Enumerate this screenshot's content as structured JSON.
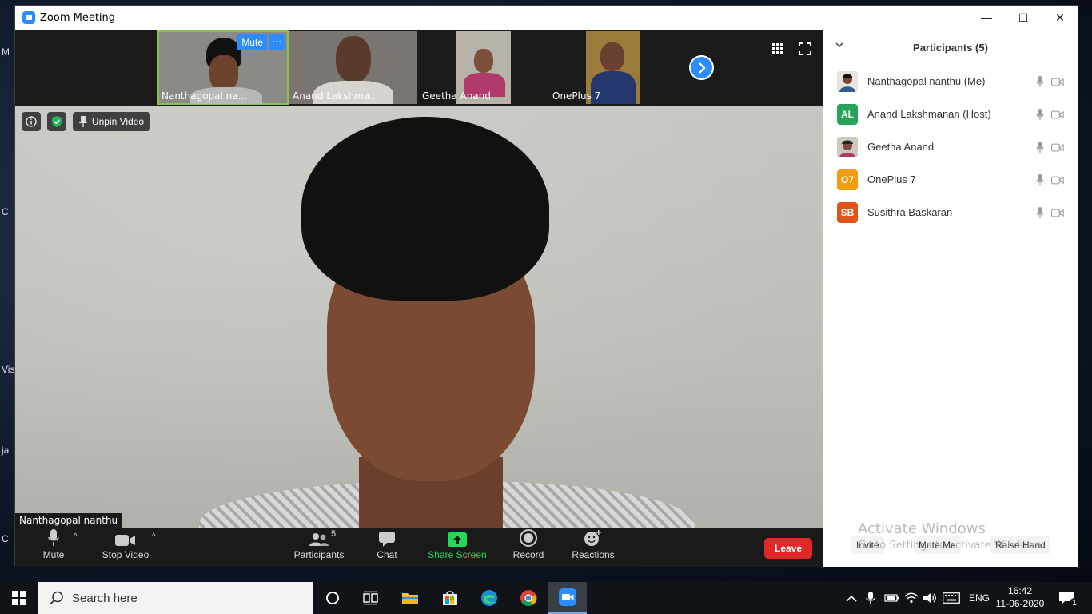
{
  "window": {
    "title": "Zoom Meeting",
    "controls": {
      "minimize": "—",
      "maximize": "☐",
      "close": "✕"
    }
  },
  "desktop_fragments": [
    "M",
    "C",
    "Vis",
    "ja",
    "C"
  ],
  "thumbnails": [
    {
      "name": "Nanthagopal na...",
      "mute_label": "Mute",
      "more_label": "···",
      "active": true
    },
    {
      "name": "Anand Lakshma..."
    },
    {
      "name": "Geetha Anand"
    },
    {
      "name": "OnePlus 7"
    }
  ],
  "overlay": {
    "unpin_label": "Unpin Video"
  },
  "main_video": {
    "name": "Nanthagopal nanthu"
  },
  "toolbar": {
    "mute_label": "Mute",
    "stop_video_label": "Stop Video",
    "participants_label": "Participants",
    "participants_count": "5",
    "chat_label": "Chat",
    "share_screen_label": "Share Screen",
    "record_label": "Record",
    "reactions_label": "Reactions",
    "leave_label": "Leave"
  },
  "panel": {
    "title": "Participants (5)",
    "participants": [
      {
        "name": "Nanthagopal nanthu (Me)",
        "initials": "",
        "color": "#5b7fa6"
      },
      {
        "name": "Anand Lakshmanan (Host)",
        "initials": "AL",
        "color": "#27a35a"
      },
      {
        "name": "Geetha Anand",
        "initials": "",
        "color": "#b58a6a"
      },
      {
        "name": "OnePlus 7",
        "initials": "O7",
        "color": "#f39c12"
      },
      {
        "name": "Susithra Baskaran",
        "initials": "SB",
        "color": "#e0541c"
      }
    ],
    "invite_label": "Invite",
    "mute_me_label": "Mute Me",
    "raise_hand_label": "Raise Hand"
  },
  "watermark": {
    "line1": "Activate Windows",
    "line2": "Go to Settings to activate Windows."
  },
  "taskbar": {
    "search_placeholder": "Search here",
    "language": "ENG",
    "time": "16:42",
    "date": "11-06-2020",
    "notification_count": "1"
  },
  "colors": {
    "accent": "#2d8cff",
    "share_green": "#23d959",
    "leave_red": "#e02828",
    "active_outline": "#8bc34a"
  }
}
